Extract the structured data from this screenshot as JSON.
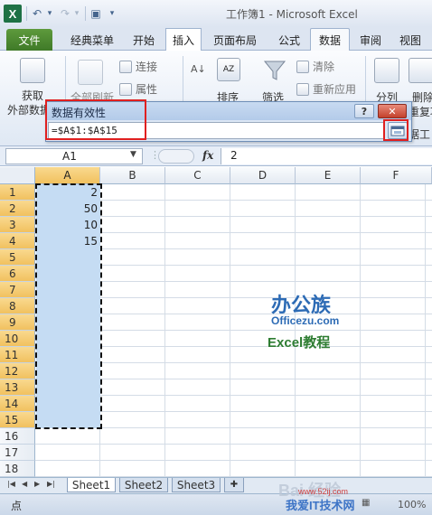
{
  "window": {
    "title": "工作簿1 - Microsoft Excel"
  },
  "qat": {
    "logo": "X",
    "undo": "↶",
    "redo": "↷",
    "save": "▣",
    "more": "▾"
  },
  "tabs": {
    "file": "文件",
    "items": [
      "经典菜单",
      "开始",
      "插入",
      "页面布局",
      "公式",
      "数据",
      "审阅",
      "视图"
    ],
    "active": "数据"
  },
  "ribbon": {
    "get_external": "获取",
    "get_external_2": "外部数据",
    "refresh_all": "全部刷新",
    "connections": "连接",
    "properties": "属性",
    "sort": "排序",
    "filter": "筛选",
    "clear": "清除",
    "reapply": "重新应用",
    "split": "分列",
    "remove_dup": "删除",
    "remove_dup_2": "重复项",
    "data_tools": "据工"
  },
  "dialog": {
    "title": "数据有效性",
    "help": "?",
    "close": "✕",
    "source": "=$A$1:$A$15"
  },
  "formula_bar": {
    "name_box": "A1",
    "fx": "fx",
    "content": "2"
  },
  "columns": [
    "A",
    "B",
    "C",
    "D",
    "E",
    "F"
  ],
  "rows": [
    "1",
    "2",
    "3",
    "4",
    "5",
    "6",
    "7",
    "8",
    "9",
    "10",
    "11",
    "12",
    "13",
    "14",
    "15",
    "16",
    "17",
    "18"
  ],
  "cells": {
    "A1": "2",
    "A2": "50",
    "A3": "10",
    "A4": "15"
  },
  "sheets": [
    "Sheet1",
    "Sheet2",
    "Sheet3"
  ],
  "status": {
    "mode": "点",
    "zoom": "100%"
  },
  "watermark": {
    "logo1": "办公族",
    "logo2": "Officezu.com",
    "logo3": "Excel教程",
    "baidu": "Bai 经验",
    "site": "我爱IT技术网",
    "site_url": "www.52ij.com"
  },
  "colors": {
    "accent": "#1e7145",
    "selection": "#c5dcf3",
    "header_selected": "#f1c15f",
    "red_highlight": "#e02020"
  }
}
